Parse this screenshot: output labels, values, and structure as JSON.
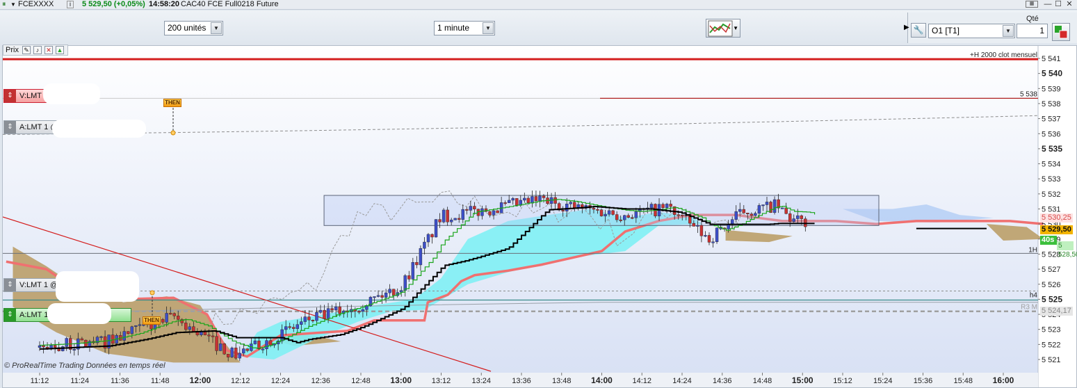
{
  "titlebar": {
    "symbol": "FCEXXXX",
    "info_icon": "i",
    "price_change": "5 529,50 (+0,05%)",
    "time": "14:58:20",
    "instrument": "CAC40 FCE Full0218 Future"
  },
  "toolbar": {
    "units_select": "200 unités",
    "interval_select": "1 minute",
    "qty_label": "Qté",
    "account_select": "O1 [T1]",
    "qty_value": "1"
  },
  "chart": {
    "price_panel_label": "Prix",
    "watermark": "© ProRealTime Trading  Données en temps réel",
    "orders": [
      {
        "label": "V:LMT",
        "kind": "sell"
      },
      {
        "label": "A:LMT 1 @",
        "kind": "buy-pending"
      },
      {
        "label": "V:LMT 1 @",
        "kind": "sell-pending"
      },
      {
        "label": "A:LMT 1",
        "kind": "buy"
      }
    ],
    "then_label": "THEN",
    "line_labels": {
      "monthly": "+H 2000 clot mensuel",
      "level_5538": "5 538",
      "h1": "1H",
      "h4": "h4",
      "r3": "R3 M"
    },
    "price_tags": {
      "upper": "5 530,25",
      "last": "5 529,50",
      "countdown": "40s",
      "lower": "5 528,50",
      "bottom": "5 524,17"
    },
    "price_axis": [
      "5 541",
      "5 540",
      "5 539",
      "5 538",
      "5 537",
      "5 536",
      "5 535",
      "5 534",
      "5 533",
      "5 532",
      "5 531",
      "5 530",
      "5 529",
      "5 528",
      "5 527",
      "5 526",
      "5 525",
      "5 524",
      "5 523",
      "5 522",
      "5 521"
    ],
    "bold_prices": [
      "5 540",
      "5 535",
      "5 525"
    ],
    "time_axis": [
      "11:12",
      "11:24",
      "11:36",
      "11:48",
      "12:00",
      "12:12",
      "12:24",
      "12:36",
      "12:48",
      "13:00",
      "13:12",
      "13:24",
      "13:36",
      "13:48",
      "14:00",
      "14:12",
      "14:24",
      "14:36",
      "14:48",
      "15:00",
      "15:12",
      "15:24",
      "15:36",
      "15:48",
      "16:00"
    ],
    "bold_times": [
      "12:00",
      "13:00",
      "14:00",
      "15:00",
      "16:00"
    ],
    "colors": {
      "bull_candle": "#3d4fc8",
      "bear_candle": "#c83232",
      "kumo_bull": "#7ff0f4",
      "kumo_bear": "#b89a60",
      "kijun": "#000000",
      "tenkan": "#1aa51a",
      "senkou_b": "#f07070",
      "resistance": "#d41e1e"
    }
  }
}
